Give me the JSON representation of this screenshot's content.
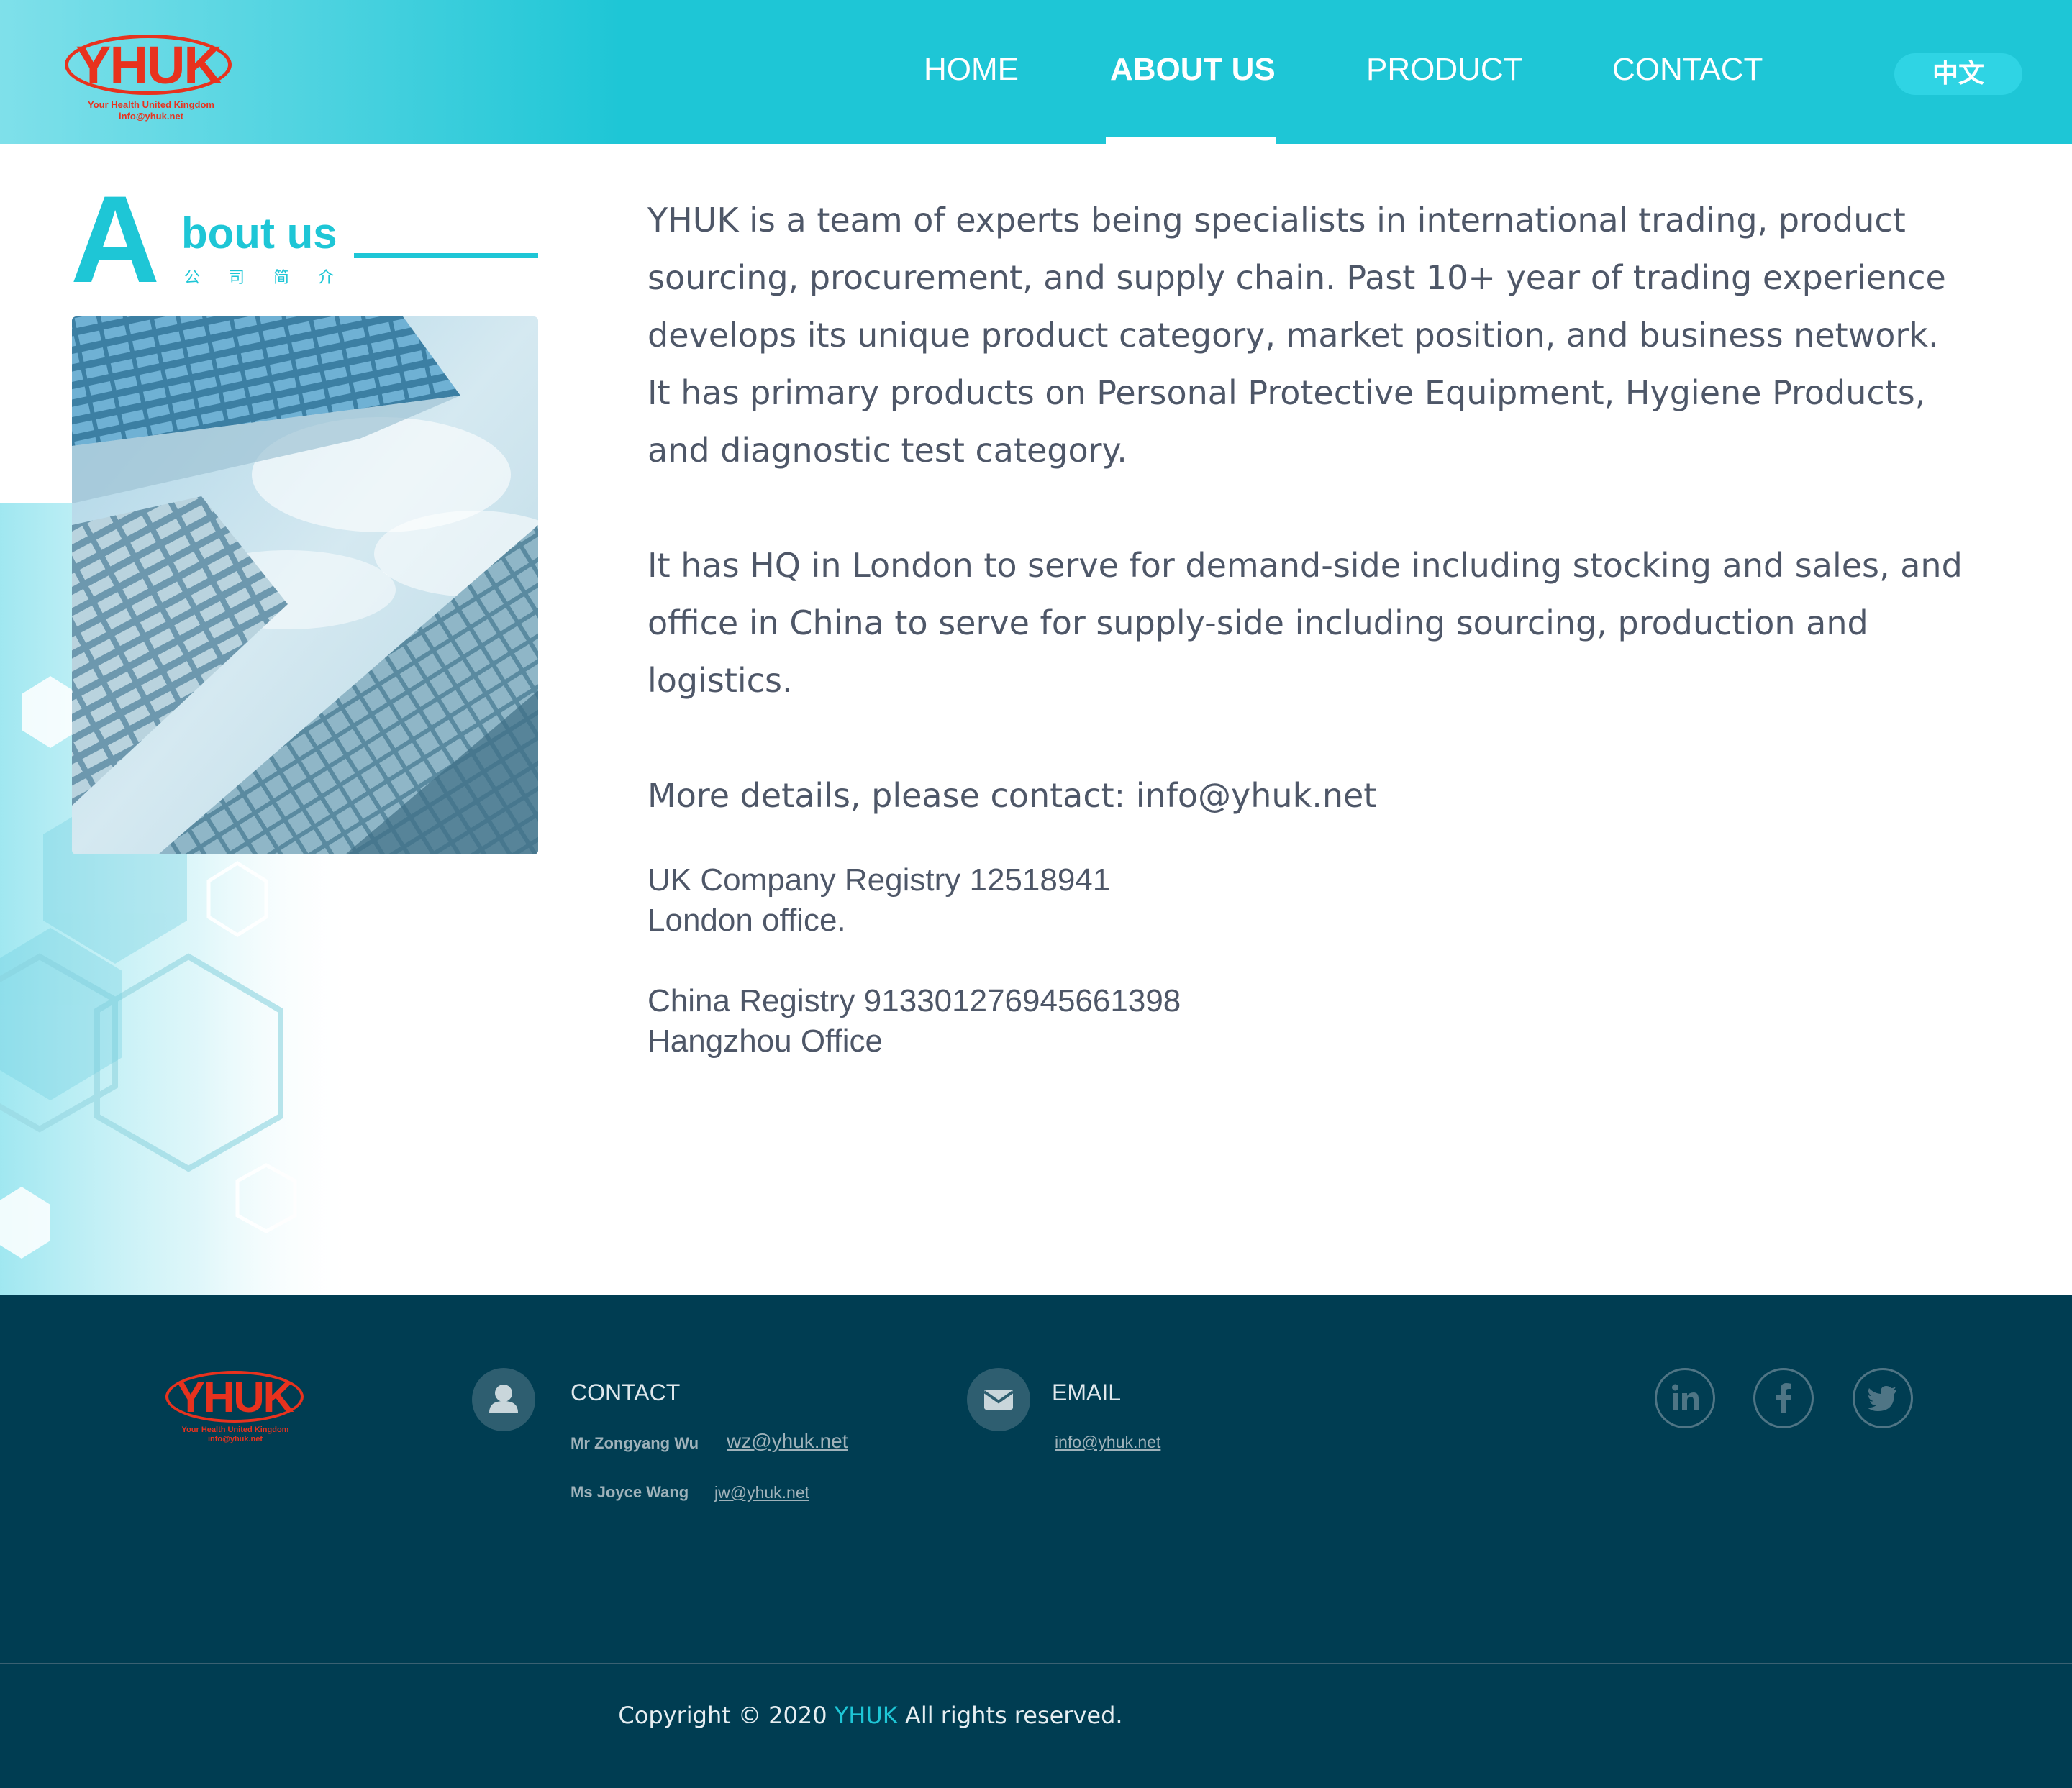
{
  "header": {
    "logo_text": "YHUK",
    "logo_tagline": "Your Health United Kingdom",
    "logo_email": "info@yhuk.net",
    "nav": [
      {
        "label": "HOME"
      },
      {
        "label": "ABOUT US",
        "active": true
      },
      {
        "label": "PRODUCT"
      },
      {
        "label": "CONTACT"
      }
    ],
    "lang_button": "中文"
  },
  "about": {
    "big_letter": "A",
    "title_rest": "bout us",
    "subtitle_cn": "公司简介",
    "paragraphs": [
      "YHUK is a team of experts being specialists in international trading, product sourcing, procurement, and supply chain. Past 10+ year of trading experience develops its unique product category, market position, and business network. It has primary products on Personal Protective Equipment, Hygiene Products, and diagnostic test category.",
      "It has HQ in London to serve for demand-side including stocking and sales, and office in China to serve for supply-side including sourcing, production and logistics.",
      "More details, please contact: info@yhuk.net"
    ],
    "uk_registry": "UK Company Registry 12518941",
    "uk_office": "London office.",
    "cn_registry": "China Registry 913301276945661398",
    "cn_office": "Hangzhou Office"
  },
  "footer": {
    "logo_text": "YHUK",
    "logo_tagline": "Your Health United Kingdom",
    "logo_email": "info@yhuk.net",
    "contact_heading": "CONTACT",
    "contacts": [
      {
        "name": "Mr Zongyang Wu",
        "email": "wz@yhuk.net"
      },
      {
        "name": "Ms Joyce Wang",
        "email": "jw@yhuk.net"
      }
    ],
    "email_heading": "EMAIL",
    "email": "info@yhuk.net",
    "social": [
      "linkedin-icon",
      "facebook-icon",
      "twitter-icon"
    ],
    "copyright_prefix": "Copyright ©  2020 ",
    "copyright_brand": "YHUK",
    "copyright_suffix": " All rights reserved."
  },
  "colors": {
    "accent": "#1ec6d6",
    "logo_red": "#e8321e",
    "footer_bg": "#003d52",
    "body_text": "#4e5768"
  }
}
